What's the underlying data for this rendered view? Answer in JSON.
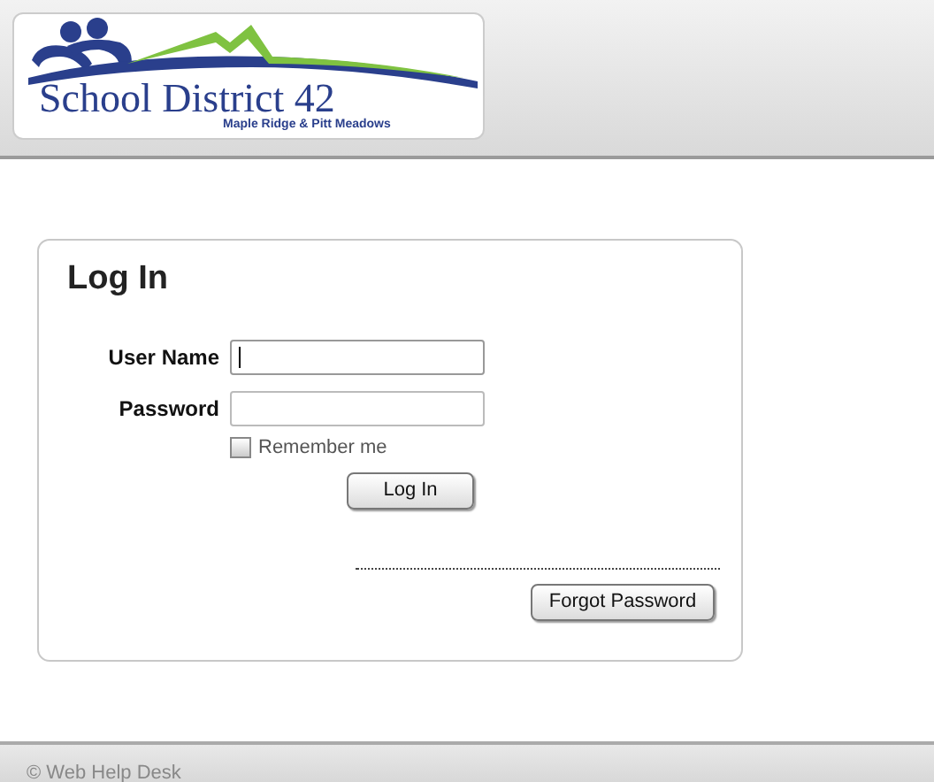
{
  "logo": {
    "title": "School District 42",
    "subtitle": "Maple Ridge & Pitt Meadows"
  },
  "login": {
    "heading": "Log In",
    "fields": [
      {
        "label": "User Name",
        "focused": true
      },
      {
        "label": "Password",
        "focused": false
      }
    ],
    "remember": {
      "label": "Remember me",
      "checked": false
    },
    "submit": "Log In",
    "forgot": "Forgot Password"
  },
  "footer": "© Web Help Desk"
}
